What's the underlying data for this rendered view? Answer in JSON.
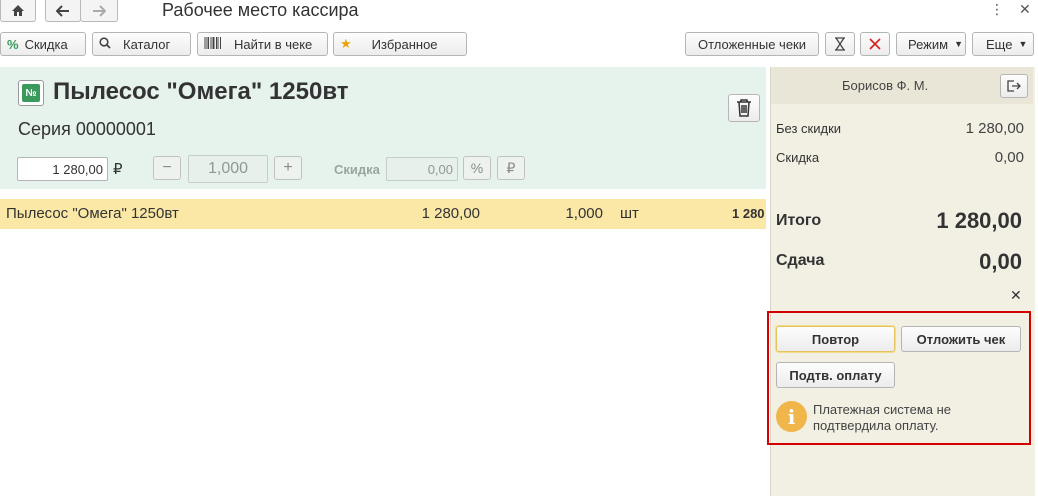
{
  "window": {
    "title": "Рабочее место кассира",
    "home_icon": "home-icon",
    "back_icon": "arrow-left-icon",
    "forward_icon": "arrow-right-icon",
    "menu_icon": "vertical-dots-icon",
    "close_icon": "close-icon"
  },
  "toolbar": {
    "discount": "Скидка",
    "catalog": "Каталог",
    "find_in_receipt": "Найти в чеке",
    "favorites": "Избранное",
    "deferred_receipts": "Отложенные чеки",
    "mode": "Режим",
    "more": "Еще"
  },
  "product": {
    "name": "Пылесос \"Омега\" 1250вт",
    "series": "Серия 00000001",
    "price": "1 280,00",
    "currency": "₽",
    "quantity": "1,000",
    "discount_label": "Скидка",
    "discount_value": "0,00",
    "percent_symbol": "%",
    "ruble_symbol": "₽"
  },
  "receipt_rows": [
    {
      "name": "Пылесос \"Омега\" 1250вт",
      "price": "1 280,00",
      "quantity": "1,000",
      "unit": "шт",
      "sum": "1 280"
    }
  ],
  "cashier": {
    "name": "Борисов Ф. М."
  },
  "summary": {
    "no_discount_label": "Без скидки",
    "no_discount_value": "1 280,00",
    "discount_label": "Скидка",
    "discount_value": "0,00",
    "total_label": "Итого",
    "total_value": "1 280,00",
    "change_label": "Сдача",
    "change_value": "0,00"
  },
  "payment": {
    "repeat": "Повтор",
    "defer_receipt": "Отложить чек",
    "confirm_payment": "Подтв. оплату",
    "message": "Платежная система не подтвердила оплату."
  },
  "colors": {
    "panel_green": "#e5f3ec",
    "row_yellow": "#fbe8a6",
    "right_panel": "#f2efe3",
    "highlight_red": "#d40000",
    "green_icon": "#3a9a5b",
    "info_orange": "#f0b64a"
  }
}
